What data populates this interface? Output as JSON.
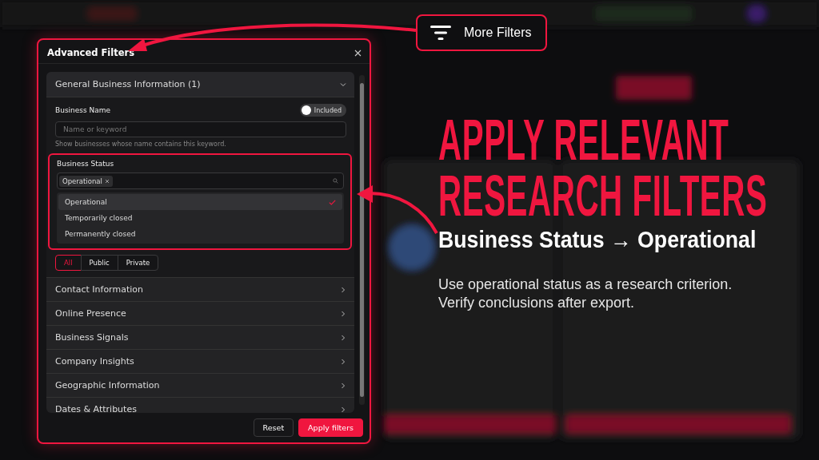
{
  "callout": {
    "label": "More Filters"
  },
  "modal": {
    "title": "Advanced Filters",
    "business_name": {
      "label": "Business Name",
      "toggle": {
        "label": "Included",
        "on": true
      },
      "placeholder": "Name or keyword",
      "hint": "Show businesses whose name contains this keyword."
    },
    "business_status": {
      "label": "Business Status",
      "tags": [
        "Operational"
      ],
      "options": [
        {
          "label": "Operational",
          "selected": true
        },
        {
          "label": "Temporarily closed",
          "selected": false
        },
        {
          "label": "Permanently closed",
          "selected": false
        }
      ]
    },
    "segments": [
      {
        "label": "All",
        "selected": true
      },
      {
        "label": "Public",
        "selected": false
      },
      {
        "label": "Private",
        "selected": false
      }
    ],
    "sections": [
      {
        "title": "General Business Information (1)",
        "expanded": true
      },
      {
        "title": "Contact Information",
        "expanded": false
      },
      {
        "title": "Online Presence",
        "expanded": false
      },
      {
        "title": "Business Signals",
        "expanded": false
      },
      {
        "title": "Company Insights",
        "expanded": false
      },
      {
        "title": "Geographic Information",
        "expanded": false
      },
      {
        "title": "Dates & Attributes",
        "expanded": false
      }
    ],
    "buttons": {
      "reset": "Reset",
      "apply": "Apply filters"
    }
  },
  "headline": {
    "lines": [
      "APPLY RELEVANT",
      "RESEARCH FILTERS"
    ],
    "subtitle": "Business Status → Operational",
    "body": [
      "Use operational status as a research criterion.",
      "Verify conclusions after export."
    ]
  }
}
